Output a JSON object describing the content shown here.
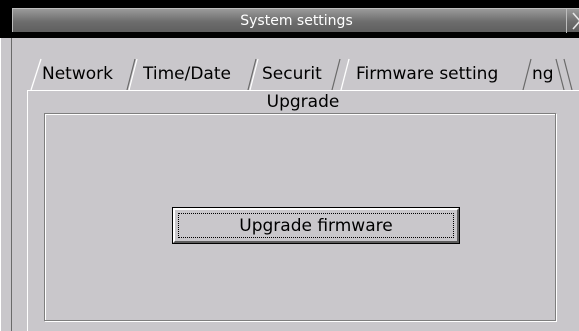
{
  "window": {
    "title": "System settings",
    "close_icon": "close-x-icon"
  },
  "tabs": [
    {
      "label": "Network",
      "active": false
    },
    {
      "label": "Time/Date",
      "active": false
    },
    {
      "label": "Securit",
      "active": false
    },
    {
      "label": "Firmware setting",
      "active": true
    },
    {
      "label": "ng",
      "active": false
    }
  ],
  "group": {
    "title": "Upgrade",
    "button_label": "Upgrade firmware"
  },
  "colors": {
    "background": "#c9c7cb",
    "titlebar": "#6d6d6d"
  }
}
